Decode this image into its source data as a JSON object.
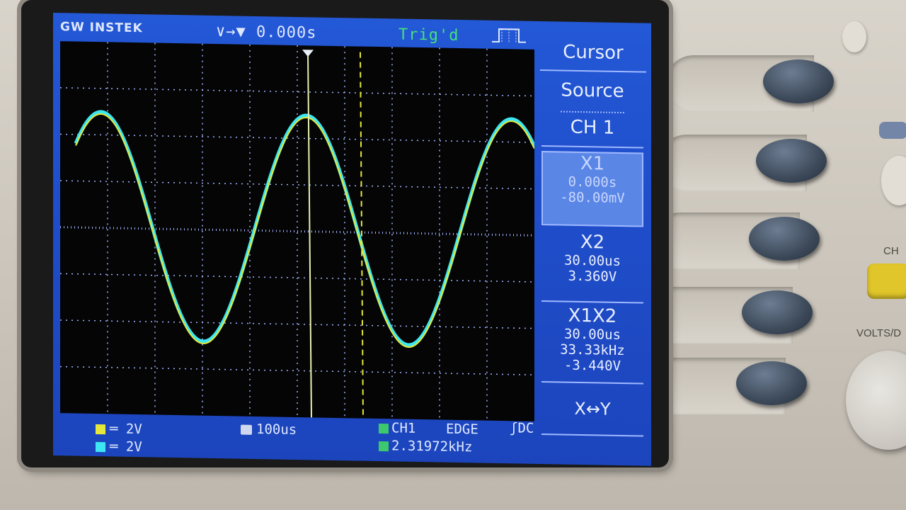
{
  "header": {
    "brand": "GW INSTEK",
    "time_position": "∨→▼ 0.000s",
    "trigger_status": "Trig'd"
  },
  "menu": {
    "title": "Cursor",
    "source_label": "Source",
    "source_value": "CH 1",
    "x1": {
      "label": "X1",
      "time": "0.000s",
      "voltage": "-80.00mV"
    },
    "x2": {
      "label": "X2",
      "time": "30.00us",
      "voltage": "3.360V"
    },
    "x1x2": {
      "label": "X1X2",
      "delta_time": "30.00us",
      "frequency": "33.33kHz",
      "delta_voltage": "-3.440V"
    },
    "xy_label": "X↔Y"
  },
  "status": {
    "ch1_scale": "2V",
    "ch2_scale": "2V",
    "timebase": "100us",
    "trigger_source": "CH1",
    "trigger_type": "EDGE",
    "coupling": "DC",
    "frequency": "2.31972kHz"
  },
  "panel": {
    "ch_label": "CH",
    "volts_label": "VOLTS/D"
  },
  "colors": {
    "screen": "#1f4cc8",
    "ch1": "#e4e83a",
    "ch2": "#3de6f0",
    "trigger": "#45e07a"
  }
}
